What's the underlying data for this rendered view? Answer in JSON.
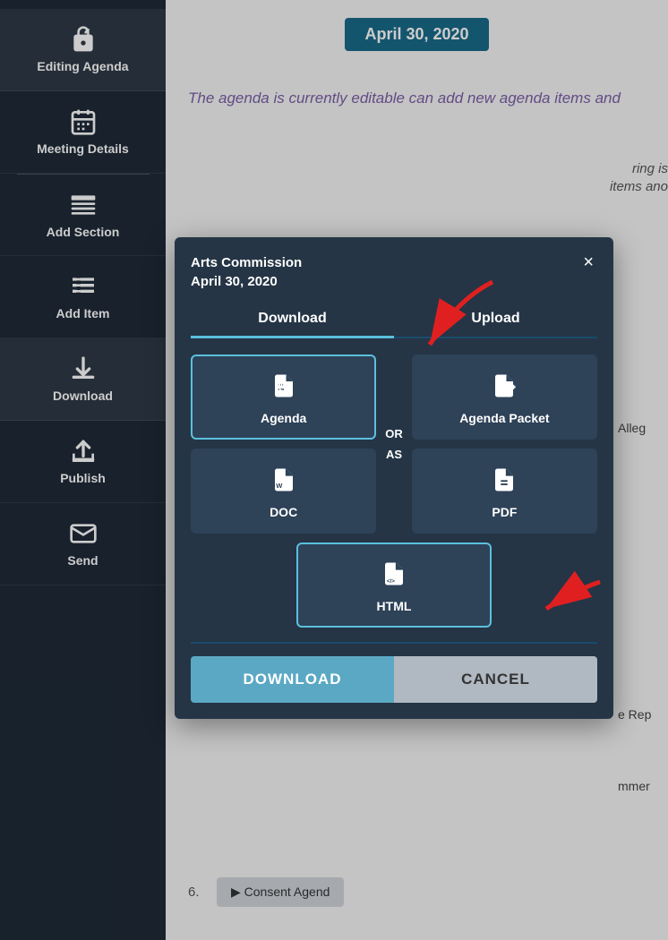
{
  "sidebar": {
    "items": [
      {
        "id": "editing-agenda",
        "label": "Editing\nAgenda",
        "icon": "lock"
      },
      {
        "id": "meeting-details",
        "label": "Meeting\nDetails",
        "icon": "calendar"
      },
      {
        "id": "add-section",
        "label": "Add Section",
        "icon": "sections"
      },
      {
        "id": "add-item",
        "label": "Add Item",
        "icon": "items"
      },
      {
        "id": "download",
        "label": "Download",
        "icon": "download"
      },
      {
        "id": "publish",
        "label": "Publish",
        "icon": "publish"
      },
      {
        "id": "send",
        "label": "Send",
        "icon": "send"
      }
    ]
  },
  "main": {
    "date_badge": "April 30, 2020",
    "editable_notice": "The agenda is currently editable\ncan add new agenda items and"
  },
  "modal": {
    "org_name": "Arts Commission",
    "date": "April 30, 2020",
    "close_label": "×",
    "tabs": [
      {
        "id": "download",
        "label": "Download",
        "active": true
      },
      {
        "id": "upload",
        "label": "Upload",
        "active": false
      }
    ],
    "formats": [
      {
        "id": "agenda",
        "label": "Agenda",
        "icon": "📎",
        "selected": true
      },
      {
        "id": "agenda-packet",
        "label": "Agenda Packet",
        "icon": "📎",
        "selected": false
      },
      {
        "id": "doc",
        "label": "DOC",
        "icon": "📄",
        "selected": false
      },
      {
        "id": "pdf",
        "label": "PDF",
        "icon": "📄",
        "selected": false
      },
      {
        "id": "html",
        "label": "HTML",
        "icon": "📄",
        "selected": true
      }
    ],
    "or_label": "OR",
    "as_label": "AS",
    "download_btn": "DOWNLOAD",
    "cancel_btn": "CANCEL"
  },
  "bottom": {
    "item_number": "6.",
    "consent_agenda_label": "▶  Consent Agend"
  },
  "colors": {
    "sidebar_bg": "#1e2a38",
    "modal_bg": "#253545",
    "accent": "#5bc0de",
    "download_btn": "#5ba8c4",
    "cancel_btn": "#b0b8c1"
  }
}
